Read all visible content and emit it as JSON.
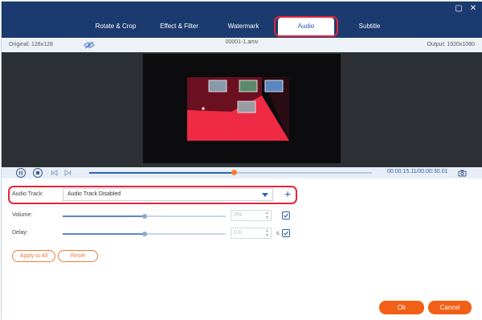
{
  "window": {
    "controls": {
      "close_glyph": "✕",
      "restore_glyph": "▢"
    },
    "tabs": [
      {
        "label": "Rotate & Crop"
      },
      {
        "label": "Effect & Filter"
      },
      {
        "label": "Watermark"
      },
      {
        "label": "Audio",
        "active": true
      },
      {
        "label": "Subtitle"
      }
    ]
  },
  "infobar": {
    "original": "Original: 128x128",
    "filename": "00001-1.amv",
    "output": "Output: 1920x1080"
  },
  "playback": {
    "progress_fraction": 0.51,
    "time": "00:00:15.11/00:00:30.01"
  },
  "audio": {
    "track_label": "Audio Track:",
    "track_value": "Audio Track Disabled",
    "volume_label": "Volume:",
    "volume_value": "0%",
    "volume_level": 0.5,
    "delay_label": "Delay:",
    "delay_value": "0.0",
    "delay_unit": "s",
    "delay_level": 0.5
  },
  "buttons": {
    "apply_all": "Apply to All",
    "reset": "Reset",
    "ok": "Ok",
    "cancel": "Cancel"
  },
  "colors": {
    "title_bar": "#1b3a6f",
    "accent_orange": "#f25f16",
    "accent_blue": "#2e5fa8",
    "highlight_red": "#e4253a"
  },
  "icons": {
    "preview_toggle": "eye-slash-icon",
    "pause": "pause-icon",
    "stop": "stop-icon",
    "previous": "skip-back-icon",
    "next": "skip-forward-icon",
    "snapshot": "camera-icon",
    "add_track": "plus-icon",
    "copy_volume": "copy-check-icon",
    "copy_delay": "copy-check-icon"
  }
}
